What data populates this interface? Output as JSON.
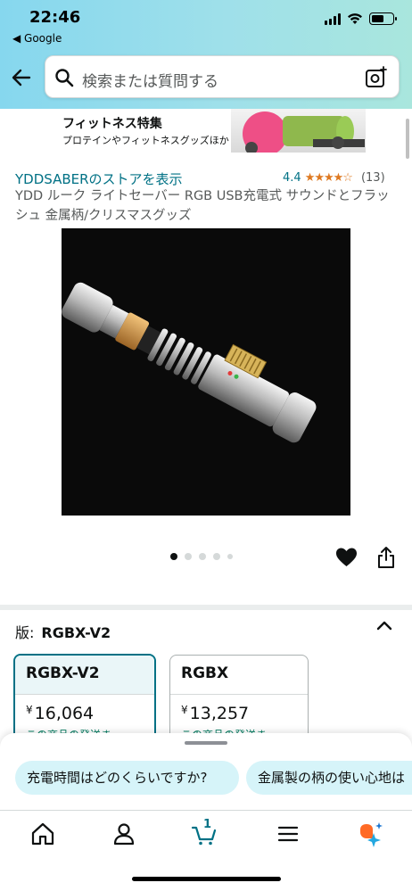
{
  "status_bar": {
    "time": "22:46",
    "back_app": "◀ Google"
  },
  "search": {
    "placeholder": "検索または質問する"
  },
  "banner": {
    "title": "フィットネス特集",
    "subtitle": "プロテインやフィットネスグッズほか"
  },
  "product": {
    "store_link": "YDDSABERのストアを表示",
    "rating_value": "4.4",
    "rating_stars": "★★★★☆",
    "rating_count": "(13)",
    "title": "YDD ルーク ライトセーバー RGB USB充電式 サウンドとフラッシュ 金属柄/クリスマスグッズ",
    "image_count": 5,
    "active_image_index": 0
  },
  "variant": {
    "label": "版:",
    "selected_value": "RGBX-V2",
    "options": [
      {
        "name": "RGBX-V2",
        "currency": "¥",
        "price": "16,064",
        "stock": "この商品の発送ま"
      },
      {
        "name": "RGBX",
        "currency": "¥",
        "price": "13,257",
        "stock": "この商品の発送ま"
      }
    ]
  },
  "suggestions": [
    "充電時間はどのくらいですか?",
    "金属製の柄の使い心地は"
  ],
  "tabbar": {
    "cart_count": "1",
    "items": [
      "home-icon",
      "account-icon",
      "cart-icon",
      "menu-icon",
      "rufus-icon"
    ]
  },
  "colors": {
    "link": "#007185",
    "star": "#de7921",
    "header_gradient_start": "#86d7ee",
    "header_gradient_end": "#a9e6dd",
    "chip_bg": "#d6f4f9",
    "selected_border": "#007185"
  }
}
